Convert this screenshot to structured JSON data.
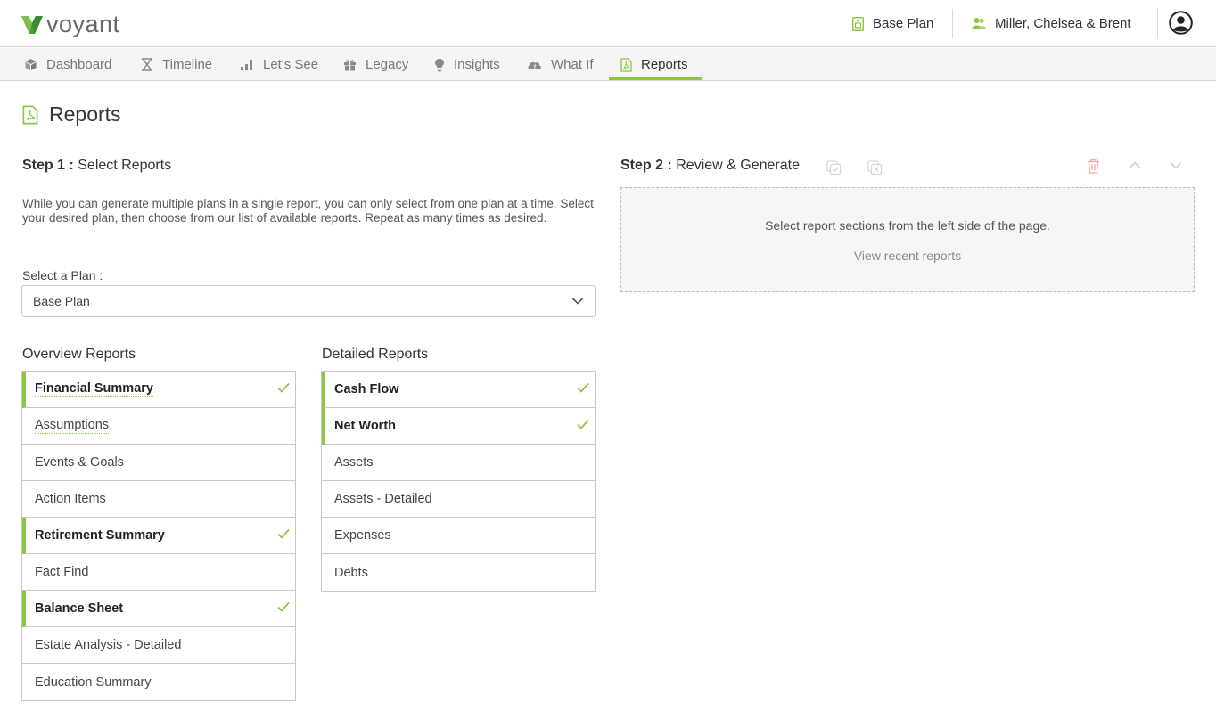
{
  "brand": {
    "name": "voyant",
    "accent": "#8cc63f"
  },
  "header": {
    "plan_label": "Base Plan",
    "clients_label": "Miller, Chelsea & Brent"
  },
  "nav": {
    "tabs": [
      {
        "label": "Dashboard",
        "icon": "cube-icon"
      },
      {
        "label": "Timeline",
        "icon": "hourglass-icon"
      },
      {
        "label": "Let's See",
        "icon": "bar-chart-icon"
      },
      {
        "label": "Legacy",
        "icon": "gift-icon"
      },
      {
        "label": "Insights",
        "icon": "lightbulb-icon"
      },
      {
        "label": "What If",
        "icon": "cloud-icon"
      },
      {
        "label": "Reports",
        "icon": "pdf-icon",
        "active": true
      }
    ]
  },
  "page": {
    "title": "Reports"
  },
  "step1": {
    "label": "Step 1 :",
    "title": "Select Reports",
    "intro": "While you can generate multiple plans in a single report, you can only select from one plan at a time. Select your desired plan, then choose from our list of available reports. Repeat as many times as desired.",
    "select_label": "Select a Plan :",
    "selected_plan": "Base Plan"
  },
  "overview": {
    "heading": "Overview Reports",
    "items": [
      {
        "label": "Financial Summary",
        "selected": true
      },
      {
        "label": "Assumptions",
        "selected": false
      },
      {
        "label": "Events & Goals",
        "selected": false
      },
      {
        "label": "Action Items",
        "selected": false
      },
      {
        "label": "Retirement Summary",
        "selected": true
      },
      {
        "label": "Fact Find",
        "selected": false
      },
      {
        "label": "Balance Sheet",
        "selected": true
      },
      {
        "label": "Estate Analysis - Detailed",
        "selected": false
      },
      {
        "label": "Education Summary",
        "selected": false
      }
    ]
  },
  "detailed": {
    "heading": "Detailed Reports",
    "items": [
      {
        "label": "Cash Flow",
        "selected": true
      },
      {
        "label": "Net Worth",
        "selected": true
      },
      {
        "label": "Assets",
        "selected": false
      },
      {
        "label": "Assets - Detailed",
        "selected": false
      },
      {
        "label": "Expenses",
        "selected": false
      },
      {
        "label": "Debts",
        "selected": false
      }
    ]
  },
  "step2": {
    "label": "Step 2 :",
    "title": "Review & Generate",
    "empty_message": "Select report sections from the left side of the page.",
    "recent_link": "View recent reports"
  }
}
